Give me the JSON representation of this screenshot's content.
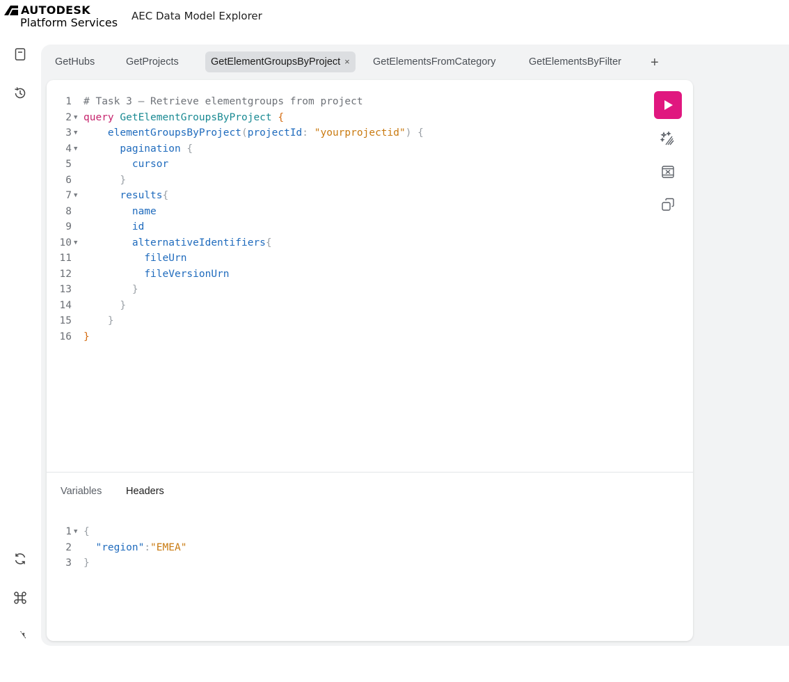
{
  "header": {
    "brand_top": "AUTODESK",
    "brand_bottom": "Platform Services",
    "app_title": "AEC Data Model Explorer"
  },
  "sidebar": {
    "icons": [
      "docs-icon",
      "history-icon",
      "refetch-icon",
      "shortcuts-icon",
      "settings-icon"
    ]
  },
  "tabs": [
    {
      "label": "GetHubs",
      "active": false
    },
    {
      "label": "GetProjects",
      "active": false
    },
    {
      "label": "GetElementGroupsByProject",
      "active": true,
      "close": "×"
    },
    {
      "label": "GetElementsFromCategory",
      "active": false
    },
    {
      "label": "GetElementsByFilter",
      "active": false
    }
  ],
  "add_tab": "+",
  "editor": {
    "lines": [
      {
        "n": "1",
        "fold": false,
        "tokens": [
          [
            "c-comment",
            "# Task 3 – Retrieve elementgroups from project"
          ]
        ]
      },
      {
        "n": "2",
        "fold": true,
        "tokens": [
          [
            "c-keyword",
            "query "
          ],
          [
            "c-def",
            "GetElementGroupsByProject "
          ],
          [
            "c-brace",
            "{"
          ]
        ]
      },
      {
        "n": "3",
        "fold": true,
        "tokens": [
          [
            "",
            "    "
          ],
          [
            "c-field",
            "elementGroupsByProject"
          ],
          [
            "c-punct",
            "("
          ],
          [
            "c-var",
            "projectId"
          ],
          [
            "c-punct",
            ": "
          ],
          [
            "c-string",
            "\"yourprojectid\""
          ],
          [
            "c-punct",
            ") {"
          ]
        ]
      },
      {
        "n": "4",
        "fold": true,
        "tokens": [
          [
            "",
            "      "
          ],
          [
            "c-field",
            "pagination "
          ],
          [
            "c-punct",
            "{"
          ]
        ]
      },
      {
        "n": "5",
        "fold": false,
        "tokens": [
          [
            "",
            "        "
          ],
          [
            "c-field",
            "cursor"
          ]
        ]
      },
      {
        "n": "6",
        "fold": false,
        "tokens": [
          [
            "",
            "      "
          ],
          [
            "c-punct",
            "}"
          ]
        ]
      },
      {
        "n": "7",
        "fold": true,
        "tokens": [
          [
            "",
            "      "
          ],
          [
            "c-field",
            "results"
          ],
          [
            "c-punct",
            "{"
          ]
        ]
      },
      {
        "n": "8",
        "fold": false,
        "tokens": [
          [
            "",
            "        "
          ],
          [
            "c-field",
            "name"
          ]
        ]
      },
      {
        "n": "9",
        "fold": false,
        "tokens": [
          [
            "",
            "        "
          ],
          [
            "c-field",
            "id"
          ]
        ]
      },
      {
        "n": "10",
        "fold": true,
        "tokens": [
          [
            "",
            "        "
          ],
          [
            "c-field",
            "alternativeIdentifiers"
          ],
          [
            "c-punct",
            "{"
          ]
        ]
      },
      {
        "n": "11",
        "fold": false,
        "tokens": [
          [
            "",
            "          "
          ],
          [
            "c-field",
            "fileUrn"
          ]
        ]
      },
      {
        "n": "12",
        "fold": false,
        "tokens": [
          [
            "",
            "          "
          ],
          [
            "c-field",
            "fileVersionUrn"
          ]
        ]
      },
      {
        "n": "13",
        "fold": false,
        "tokens": [
          [
            "",
            "        "
          ],
          [
            "c-punct",
            "}"
          ]
        ]
      },
      {
        "n": "14",
        "fold": false,
        "tokens": [
          [
            "",
            "      "
          ],
          [
            "c-punct",
            "}"
          ]
        ]
      },
      {
        "n": "15",
        "fold": false,
        "tokens": [
          [
            "",
            "    "
          ],
          [
            "c-punct",
            "}"
          ]
        ]
      },
      {
        "n": "16",
        "fold": false,
        "tokens": [
          [
            "c-brace",
            "}"
          ]
        ]
      }
    ]
  },
  "toolbar": {
    "run": "play-icon",
    "prettify": "prettify-icon",
    "merge": "merge-fragments-icon",
    "copy": "copy-icon",
    "run_color": "#e0177f"
  },
  "secondary_tabs": [
    {
      "label": "Variables",
      "active": false
    },
    {
      "label": "Headers",
      "active": true
    }
  ],
  "variables": {
    "lines": [
      {
        "n": "1",
        "fold": true,
        "tokens": [
          [
            "c-punct",
            "{"
          ]
        ]
      },
      {
        "n": "2",
        "fold": false,
        "tokens": [
          [
            "",
            "  "
          ],
          [
            "c-field",
            "\"region\""
          ],
          [
            "c-punct",
            ":"
          ],
          [
            "c-string",
            "\"EMEA\""
          ]
        ]
      },
      {
        "n": "3",
        "fold": false,
        "tokens": [
          [
            "c-punct",
            "}"
          ]
        ]
      }
    ]
  }
}
